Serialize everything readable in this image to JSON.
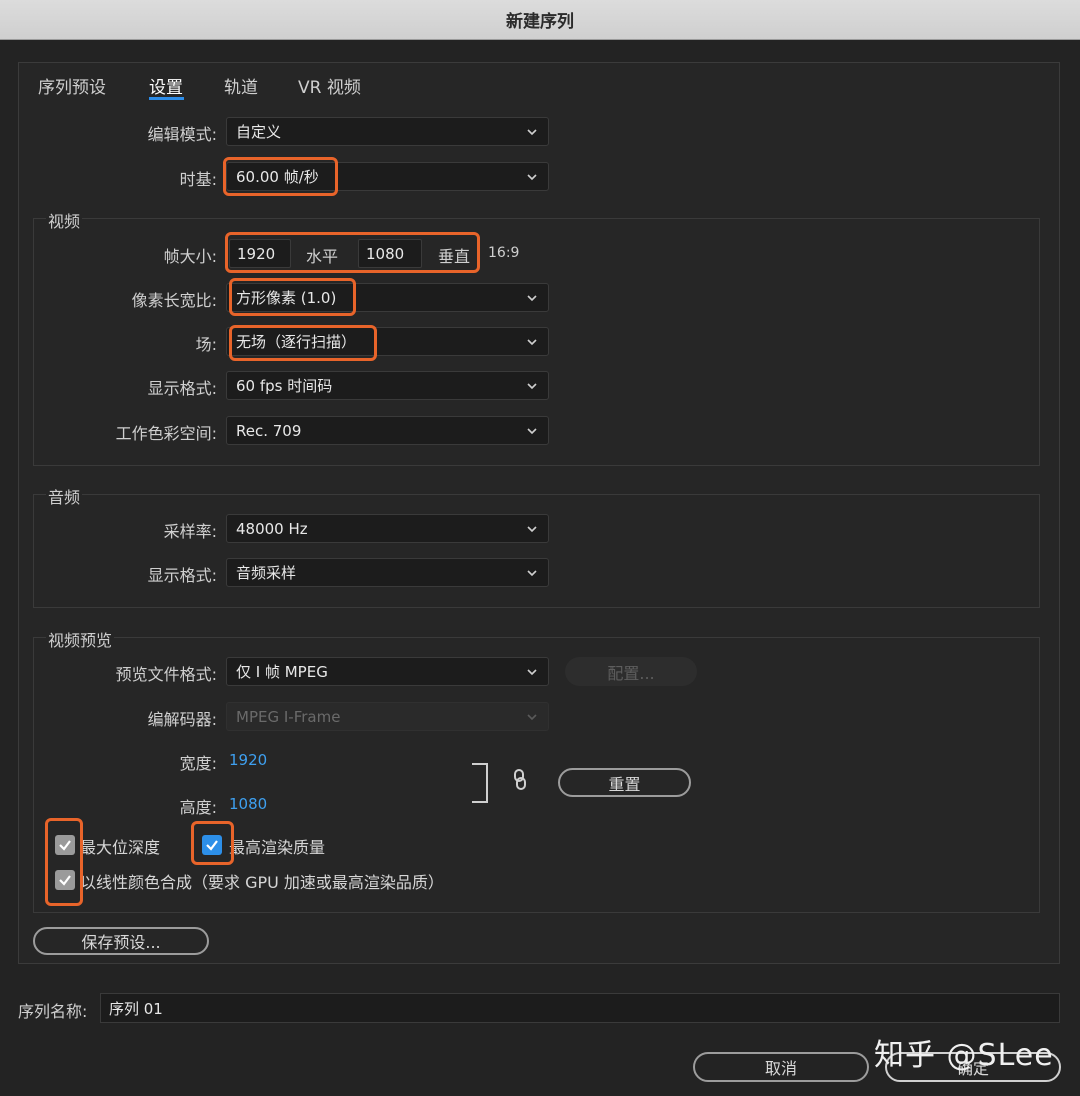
{
  "window": {
    "title": "新建序列"
  },
  "tabs": [
    {
      "label": "序列预设"
    },
    {
      "label": "设置"
    },
    {
      "label": "轨道"
    },
    {
      "label": "VR 视频"
    }
  ],
  "general": {
    "edit_mode_label": "编辑模式:",
    "edit_mode_value": "自定义",
    "timebase_label": "时基:",
    "timebase_value": "60.00  帧/秒"
  },
  "video": {
    "group_title": "视频",
    "frame_size_label": "帧大小:",
    "width": "1920",
    "horizontal_label": "水平",
    "height": "1080",
    "vertical_label": "垂直",
    "aspect": "16:9",
    "pixel_aspect_label": "像素长宽比:",
    "pixel_aspect_value": "方形像素 (1.0)",
    "fields_label": "场:",
    "fields_value": "无场（逐行扫描）",
    "display_format_label": "显示格式:",
    "display_format_value": "60 fps 时间码",
    "color_space_label": "工作色彩空间:",
    "color_space_value": "Rec. 709"
  },
  "audio": {
    "group_title": "音频",
    "sample_rate_label": "采样率:",
    "sample_rate_value": "48000 Hz",
    "display_format_label": "显示格式:",
    "display_format_value": "音频采样"
  },
  "preview": {
    "group_title": "视频预览",
    "file_format_label": "预览文件格式:",
    "file_format_value": "仅 I 帧 MPEG",
    "config_button": "配置...",
    "codec_label": "编解码器:",
    "codec_value": "MPEG I-Frame",
    "width_label": "宽度:",
    "width_value": "1920",
    "height_label": "高度:",
    "height_value": "1080",
    "reset_button": "重置",
    "max_bit_depth": "最大位深度",
    "max_render_quality": "最高渲染质量",
    "linear_color": "以线性颜色合成（要求 GPU 加速或最高渲染品质）"
  },
  "save_preset_button": "保存预设...",
  "sequence_name": {
    "label": "序列名称:",
    "value": "序列 01"
  },
  "footer": {
    "cancel_button": "取消",
    "ok_button": "确定"
  },
  "watermark": "知乎 @SLee",
  "colors": {
    "highlight": "#e8642a",
    "accent": "#2c8ce8",
    "link_value": "#3ea0f0"
  }
}
